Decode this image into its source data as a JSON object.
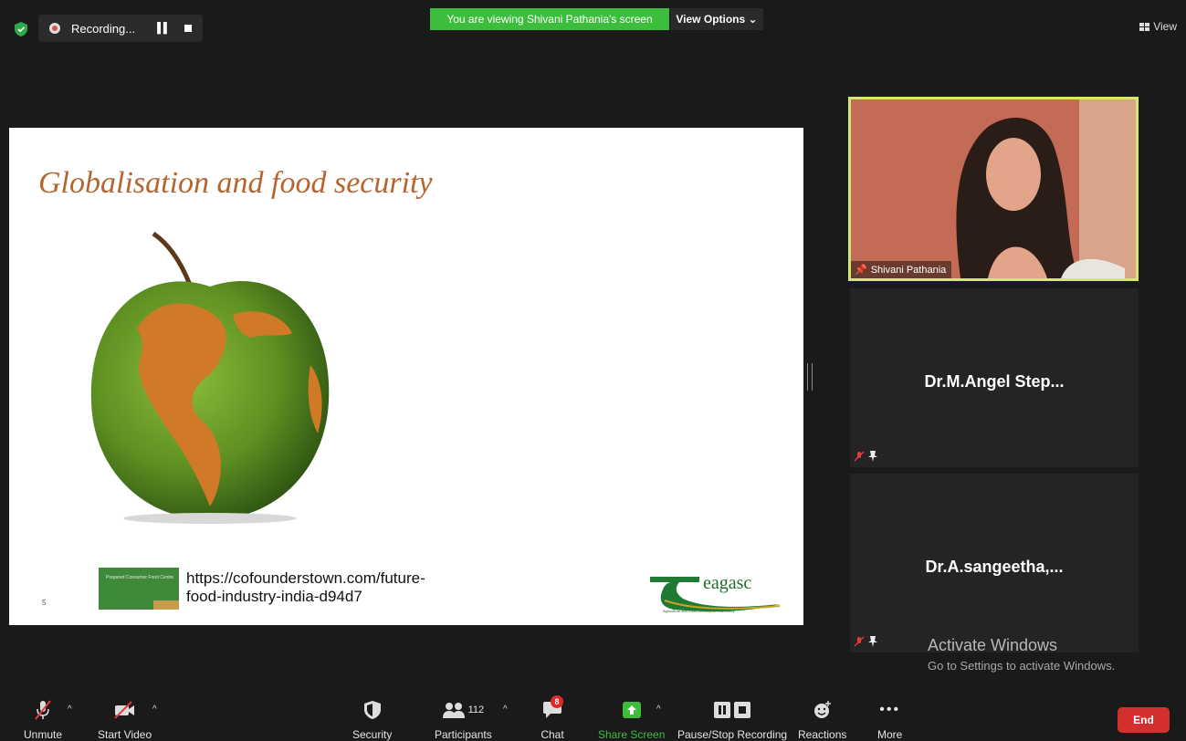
{
  "topbar": {
    "recording_label": "Recording...",
    "banner_text": "You are viewing Shivani Pathania's screen",
    "view_options_label": "View Options",
    "view_label": "View"
  },
  "slide": {
    "title": "Globalisation and food security",
    "slide_number": "5",
    "link_line1": "https://cofounderstown.com/future-",
    "link_line2": "food-industry-india-d94d7",
    "thumb_text": "Prepared Consumer Food Centre",
    "logo_word": "eagasc",
    "logo_sub": "Agriculture and Food Development Authority"
  },
  "participants": {
    "speaker_name": "Shivani Pathania",
    "tile1_name": "Dr.M.Angel Step...",
    "tile2_name": "Dr.A.sangeetha,..."
  },
  "watermark": {
    "line1": "Activate Windows",
    "line2": "Go to Settings to activate Windows."
  },
  "toolbar": {
    "unmute": "Unmute",
    "start_video": "Start Video",
    "security": "Security",
    "participants_count": "112",
    "participants": "Participants",
    "chat_badge": "8",
    "chat": "Chat",
    "share_screen": "Share Screen",
    "pause_stop_recording": "Pause/Stop Recording",
    "reactions": "Reactions",
    "more": "More",
    "end": "End"
  },
  "colors": {
    "banner_green": "#3cbe3c",
    "speaker_border": "#d6e86a",
    "end_red": "#d32f2f",
    "title_orange": "#b5652f"
  }
}
